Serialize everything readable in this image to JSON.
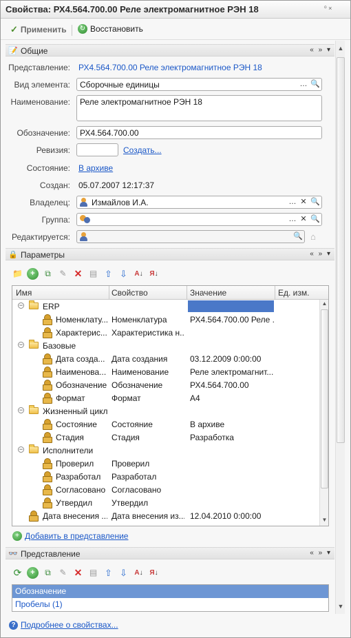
{
  "window": {
    "title": "Свойства: РХ4.564.700.00 Реле электромагнитное РЭН 18",
    "controls": "⁰  ×"
  },
  "toolbar": {
    "apply_label": "Применить",
    "restore_label": "Восстановить"
  },
  "general": {
    "header": "Общие",
    "ctrls": "« » ▾",
    "fields": {
      "predstavlenie_label": "Представление:",
      "predstavlenie_value": "РХ4.564.700.00 Реле электромагнитное РЭН 18",
      "vid_label": "Вид элемента:",
      "vid_value": "Сборочные единицы",
      "naim_label": "Наименование:",
      "naim_value": "Реле электромагнитное РЭН 18",
      "oboz_label": "Обозначение:",
      "oboz_value": "РХ4.564.700.00",
      "rev_label": "Ревизия:",
      "rev_value": "",
      "rev_link": "Создать...",
      "sost_label": "Состояние:",
      "sost_value": "В архиве",
      "sozdan_label": "Создан:",
      "sozdan_value": "05.07.2007 12:17:37",
      "vladelec_label": "Владелец:",
      "vladelec_value": "Измайлов И.А.",
      "gruppa_label": "Группа:",
      "gruppa_value": "",
      "red_label": "Редактируется:",
      "red_value": ""
    }
  },
  "params": {
    "header": "Параметры",
    "ctrls": "« » ▾",
    "columns": [
      "Имя",
      "Свойство",
      "Значение",
      "Ед. изм."
    ],
    "rows": [
      {
        "level": 0,
        "kind": "folder",
        "name": "ERP",
        "prop": "",
        "value": "",
        "unit": ""
      },
      {
        "level": 1,
        "kind": "prop",
        "name": "Номенклату...",
        "prop": "Номенклатура",
        "value": "РХ4.564.700.00 Реле ...",
        "unit": ""
      },
      {
        "level": 1,
        "kind": "prop",
        "name": "Характерис...",
        "prop": "Характеристика н...",
        "value": "",
        "unit": ""
      },
      {
        "level": 0,
        "kind": "folder",
        "name": "Базовые",
        "prop": "",
        "value": "",
        "unit": ""
      },
      {
        "level": 1,
        "kind": "prop",
        "name": "Дата созда...",
        "prop": "Дата создания",
        "value": "03.12.2009 0:00:00",
        "unit": ""
      },
      {
        "level": 1,
        "kind": "prop",
        "name": "Наименова...",
        "prop": "Наименование",
        "value": "Реле электромагнит...",
        "unit": ""
      },
      {
        "level": 1,
        "kind": "prop",
        "name": "Обозначение",
        "prop": "Обозначение",
        "value": "РХ4.564.700.00",
        "unit": ""
      },
      {
        "level": 1,
        "kind": "prop",
        "name": "Формат",
        "prop": "Формат",
        "value": "А4",
        "unit": ""
      },
      {
        "level": 0,
        "kind": "folder",
        "name": "Жизненный цикл",
        "prop": "",
        "value": "",
        "unit": ""
      },
      {
        "level": 1,
        "kind": "prop",
        "name": "Состояние",
        "prop": "Состояние",
        "value": "В архиве",
        "unit": ""
      },
      {
        "level": 1,
        "kind": "prop",
        "name": "Стадия",
        "prop": "Стадия",
        "value": "Разработка",
        "unit": ""
      },
      {
        "level": 0,
        "kind": "folder",
        "name": "Исполнители",
        "prop": "",
        "value": "",
        "unit": ""
      },
      {
        "level": 1,
        "kind": "prop",
        "name": "Проверил",
        "prop": "Проверил",
        "value": "",
        "unit": ""
      },
      {
        "level": 1,
        "kind": "prop",
        "name": "Разработал",
        "prop": "Разработал",
        "value": "",
        "unit": ""
      },
      {
        "level": 1,
        "kind": "prop",
        "name": "Согласовано",
        "prop": "Согласовано",
        "value": "",
        "unit": ""
      },
      {
        "level": 1,
        "kind": "prop",
        "name": "Утвердил",
        "prop": "Утвердил",
        "value": "",
        "unit": ""
      },
      {
        "level": -1,
        "kind": "prop",
        "name": "Дата внесения ...",
        "prop": "Дата внесения из...",
        "value": "12.04.2010 0:00:00",
        "unit": ""
      }
    ],
    "add_link": "Добавить в представление"
  },
  "view": {
    "header": "Представление",
    "ctrls": "« » ▾",
    "items": [
      "Обозначение",
      "Пробелы (1)"
    ]
  },
  "footer": {
    "link": "Подробнее о свойствах..."
  },
  "colors": {
    "link": "#1a57c7",
    "selection": "#6d96d4",
    "selected_cell": "#4a78c8"
  }
}
